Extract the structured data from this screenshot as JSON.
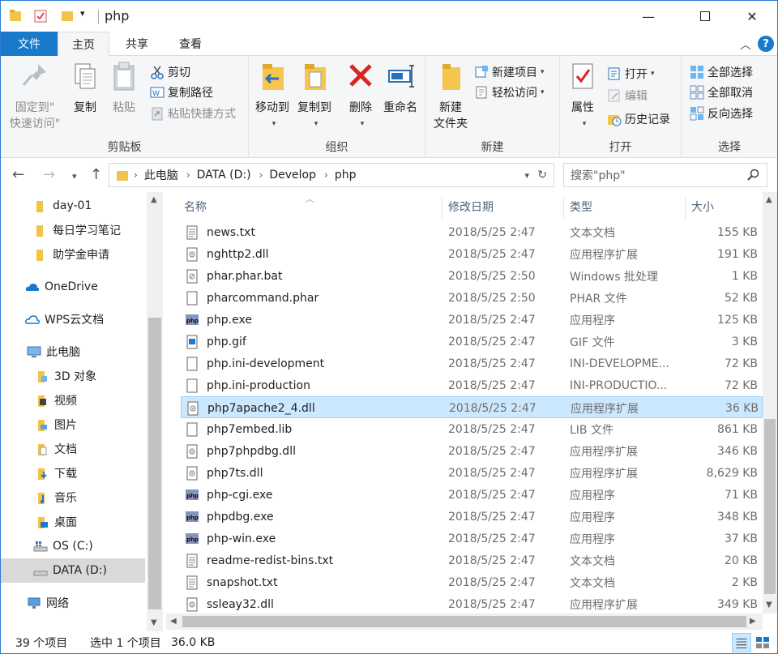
{
  "window": {
    "title": "php"
  },
  "tabs": [
    {
      "label": "文件"
    },
    {
      "label": "主页"
    },
    {
      "label": "共享"
    },
    {
      "label": "查看"
    }
  ],
  "ribbon": {
    "clipboard": {
      "group_label": "剪贴板",
      "pin_label_1": "固定到\"",
      "pin_label_2": "快速访问\"",
      "copy_label": "复制",
      "paste_label": "粘贴",
      "cut_label": "剪切",
      "copy_path_label": "复制路径",
      "paste_shortcut_label": "粘贴快捷方式"
    },
    "organize": {
      "group_label": "组织",
      "move_label": "移动到",
      "copy_to_label": "复制到",
      "delete_label": "删除",
      "rename_label": "重命名"
    },
    "new": {
      "group_label": "新建",
      "new_folder_label_1": "新建",
      "new_folder_label_2": "文件夹",
      "new_item_label": "新建项目",
      "easy_access_label": "轻松访问"
    },
    "open": {
      "group_label": "打开",
      "properties_label": "属性",
      "open_label": "打开",
      "edit_label": "编辑",
      "history_label": "历史记录"
    },
    "select": {
      "group_label": "选择",
      "select_all_label": "全部选择",
      "select_none_label": "全部取消",
      "invert_label": "反向选择"
    }
  },
  "address": {
    "crumbs": [
      "此电脑",
      "DATA (D:)",
      "Develop",
      "php"
    ],
    "search_placeholder": "搜索\"php\""
  },
  "nav": {
    "items": [
      {
        "label": "day-01",
        "icon": "folder-icon"
      },
      {
        "label": "每日学习笔记",
        "icon": "folder-icon"
      },
      {
        "label": "助学金申请",
        "icon": "folder-icon"
      },
      {
        "label": "OneDrive",
        "icon": "cloud-icon"
      },
      {
        "label": "WPS云文档",
        "icon": "cloud-outline-icon"
      },
      {
        "label": "此电脑",
        "icon": "computer-icon"
      },
      {
        "label": "3D 对象",
        "icon": "3d-objects-icon"
      },
      {
        "label": "视频",
        "icon": "videos-icon"
      },
      {
        "label": "图片",
        "icon": "pictures-icon"
      },
      {
        "label": "文档",
        "icon": "documents-icon"
      },
      {
        "label": "下载",
        "icon": "downloads-icon"
      },
      {
        "label": "音乐",
        "icon": "music-icon"
      },
      {
        "label": "桌面",
        "icon": "desktop-icon"
      },
      {
        "label": "OS (C:)",
        "icon": "windows-drive-icon"
      },
      {
        "label": "DATA (D:)",
        "icon": "drive-icon"
      },
      {
        "label": "网络",
        "icon": "network-icon"
      }
    ]
  },
  "columns": {
    "name": "名称",
    "date": "修改日期",
    "type": "类型",
    "size": "大小"
  },
  "files": [
    {
      "name": "news.txt",
      "date": "2018/5/25 2:47",
      "type": "文本文档",
      "size": "155 KB",
      "icon": "text-file-icon"
    },
    {
      "name": "nghttp2.dll",
      "date": "2018/5/25 2:47",
      "type": "应用程序扩展",
      "size": "191 KB",
      "icon": "dll-file-icon"
    },
    {
      "name": "phar.phar.bat",
      "date": "2018/5/25 2:50",
      "type": "Windows 批处理",
      "size": "1 KB",
      "icon": "bat-file-icon"
    },
    {
      "name": "pharcommand.phar",
      "date": "2018/5/25 2:50",
      "type": "PHAR 文件",
      "size": "52 KB",
      "icon": "blank-file-icon"
    },
    {
      "name": "php.exe",
      "date": "2018/5/25 2:47",
      "type": "应用程序",
      "size": "125 KB",
      "icon": "php-exe-icon"
    },
    {
      "name": "php.gif",
      "date": "2018/5/25 2:47",
      "type": "GIF 文件",
      "size": "3 KB",
      "icon": "image-file-icon"
    },
    {
      "name": "php.ini-development",
      "date": "2018/5/25 2:47",
      "type": "INI-DEVELOPME...",
      "size": "72 KB",
      "icon": "blank-file-icon"
    },
    {
      "name": "php.ini-production",
      "date": "2018/5/25 2:47",
      "type": "INI-PRODUCTIO...",
      "size": "72 KB",
      "icon": "blank-file-icon"
    },
    {
      "name": "php7apache2_4.dll",
      "date": "2018/5/25 2:47",
      "type": "应用程序扩展",
      "size": "36 KB",
      "icon": "dll-file-icon",
      "selected": true
    },
    {
      "name": "php7embed.lib",
      "date": "2018/5/25 2:47",
      "type": "LIB 文件",
      "size": "861 KB",
      "icon": "blank-file-icon"
    },
    {
      "name": "php7phpdbg.dll",
      "date": "2018/5/25 2:47",
      "type": "应用程序扩展",
      "size": "346 KB",
      "icon": "dll-file-icon"
    },
    {
      "name": "php7ts.dll",
      "date": "2018/5/25 2:47",
      "type": "应用程序扩展",
      "size": "8,629 KB",
      "icon": "dll-file-icon"
    },
    {
      "name": "php-cgi.exe",
      "date": "2018/5/25 2:47",
      "type": "应用程序",
      "size": "71 KB",
      "icon": "php-exe-icon"
    },
    {
      "name": "phpdbg.exe",
      "date": "2018/5/25 2:47",
      "type": "应用程序",
      "size": "348 KB",
      "icon": "php-exe-icon"
    },
    {
      "name": "php-win.exe",
      "date": "2018/5/25 2:47",
      "type": "应用程序",
      "size": "37 KB",
      "icon": "php-exe-icon"
    },
    {
      "name": "readme-redist-bins.txt",
      "date": "2018/5/25 2:47",
      "type": "文本文档",
      "size": "20 KB",
      "icon": "text-file-icon"
    },
    {
      "name": "snapshot.txt",
      "date": "2018/5/25 2:47",
      "type": "文本文档",
      "size": "2 KB",
      "icon": "text-file-icon"
    },
    {
      "name": "ssleay32.dll",
      "date": "2018/5/25 2:47",
      "type": "应用程序扩展",
      "size": "349 KB",
      "icon": "dll-file-icon"
    }
  ],
  "status": {
    "count": "39 个项目",
    "selection": "选中 1 个项目",
    "selection_size": "36.0 KB"
  },
  "colors": {
    "accent": "#1979ca",
    "selection_bg": "#cce8ff",
    "selection_border": "#99d1ff",
    "folder": "#f0c44a"
  }
}
